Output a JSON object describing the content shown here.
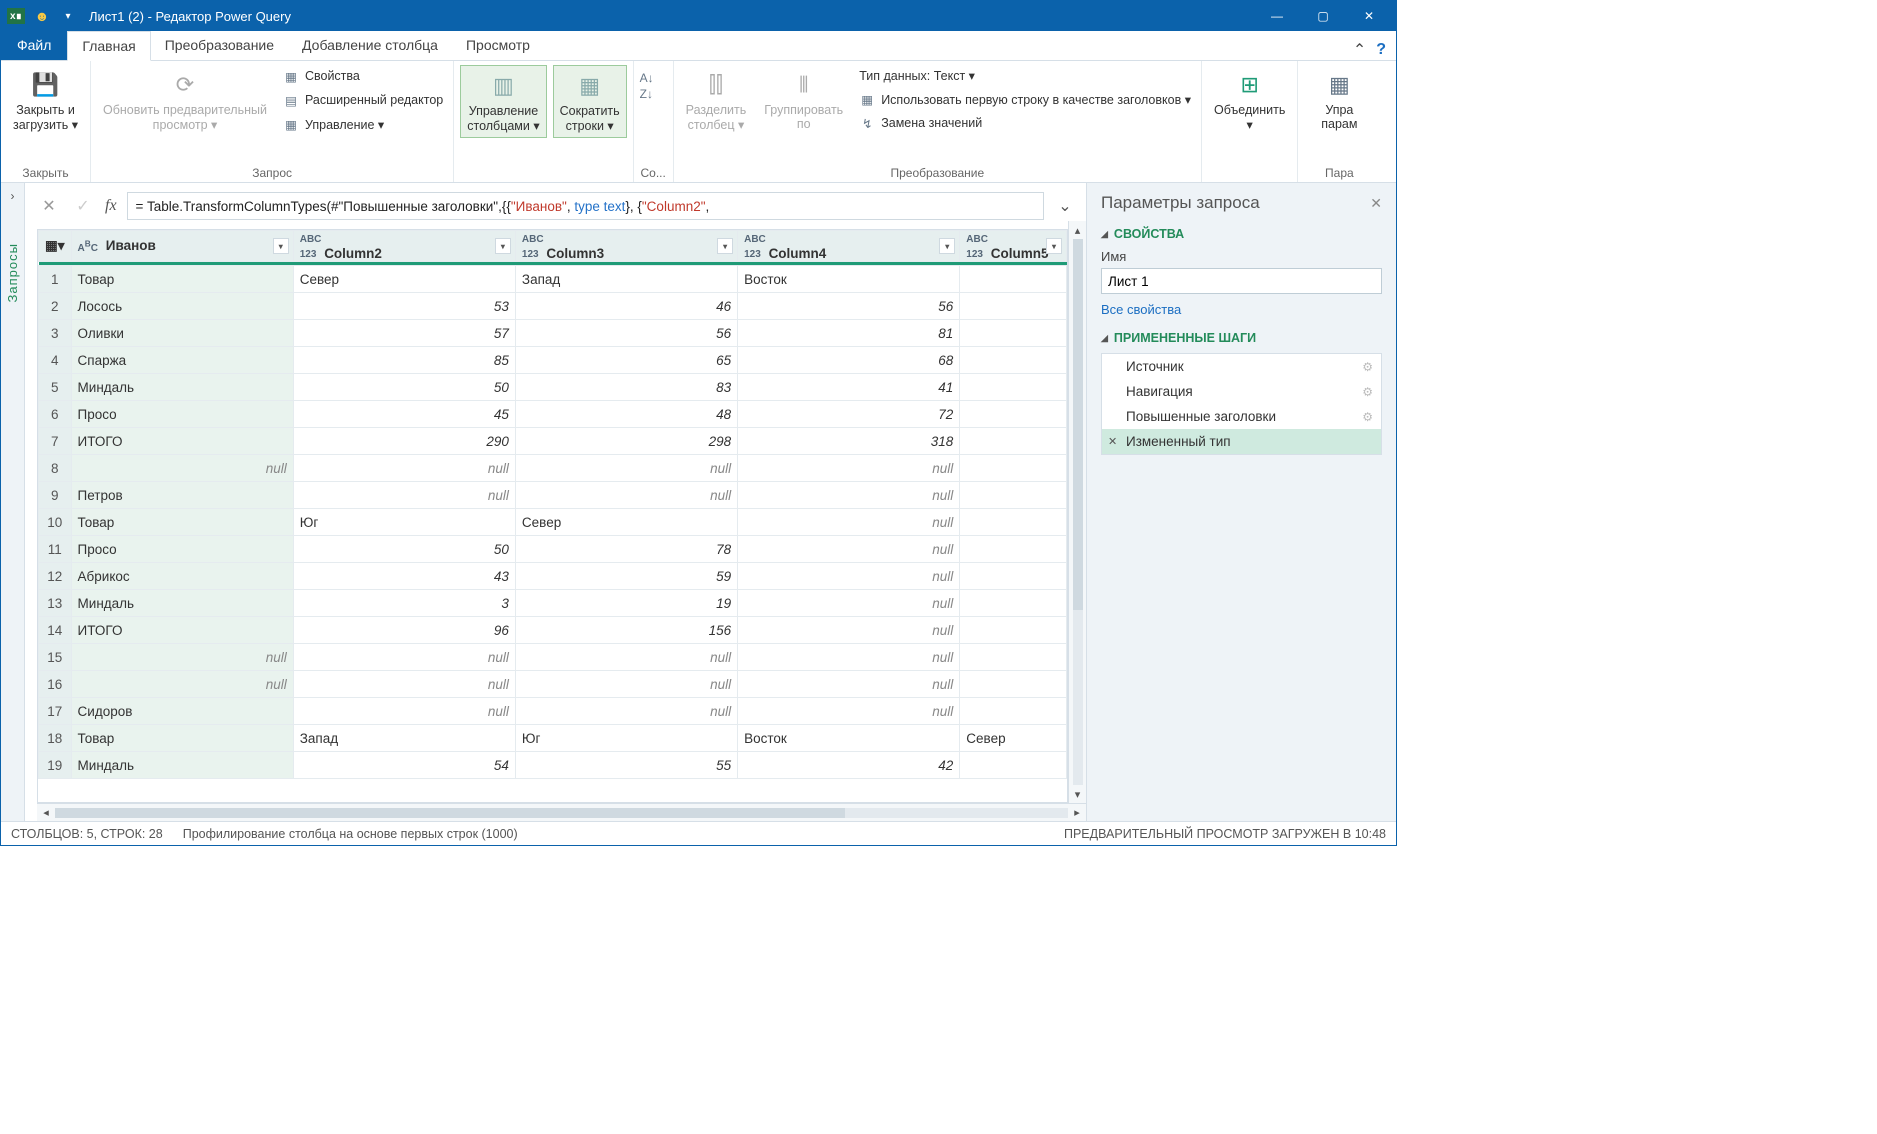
{
  "title": "Лист1 (2) - Редактор Power Query",
  "tabs": {
    "file": "Файл",
    "home": "Главная",
    "transform": "Преобразование",
    "addcol": "Добавление столбца",
    "view": "Просмотр"
  },
  "ribbon": {
    "close": {
      "label": "Закрыть и\nзагрузить ▾",
      "group": "Закрыть"
    },
    "query": {
      "refresh": "Обновить предварительный\nпросмотр ▾",
      "props": "Свойства",
      "adv": "Расширенный редактор",
      "manage": "Управление ▾",
      "group": "Запрос"
    },
    "cols": {
      "manage_cols": "Управление\nстолбцами ▾",
      "reduce_rows": "Сократить\nстроки ▾"
    },
    "sort": {
      "group": "Со..."
    },
    "split": {
      "split": "Разделить\nстолбец ▾",
      "group_by": "Группировать\nпо"
    },
    "transform": {
      "dtype": "Тип данных: Текст ▾",
      "first_row": "Использовать первую строку в качестве заголовков ▾",
      "replace": "Замена значений",
      "group": "Преобразование"
    },
    "combine": {
      "merge": "Объединить\n▾"
    },
    "params": {
      "manage": "Упра\nпарам",
      "group": "Пара"
    }
  },
  "formula": "= Table.TransformColumnTypes(#\"Повышенные заголовки\",{{\"Иванов\", type text}, {\"Column2\",",
  "columns": [
    "Иванов",
    "Column2",
    "Column3",
    "Column4",
    "Column5"
  ],
  "col_types": [
    "ABC",
    "ABC123",
    "ABC123",
    "ABC123",
    "ABC123"
  ],
  "rows": [
    {
      "n": 1,
      "c": [
        "Товар",
        "Север",
        "Запад",
        "Восток",
        ""
      ]
    },
    {
      "n": 2,
      "c": [
        "Лосось",
        "53",
        "46",
        "56",
        ""
      ]
    },
    {
      "n": 3,
      "c": [
        "Оливки",
        "57",
        "56",
        "81",
        ""
      ]
    },
    {
      "n": 4,
      "c": [
        "Спаржа",
        "85",
        "65",
        "68",
        ""
      ]
    },
    {
      "n": 5,
      "c": [
        "Миндаль",
        "50",
        "83",
        "41",
        ""
      ]
    },
    {
      "n": 6,
      "c": [
        "Просо",
        "45",
        "48",
        "72",
        ""
      ]
    },
    {
      "n": 7,
      "c": [
        "ИТОГО",
        "290",
        "298",
        "318",
        ""
      ]
    },
    {
      "n": 8,
      "c": [
        "null",
        "null",
        "null",
        "null",
        ""
      ]
    },
    {
      "n": 9,
      "c": [
        "Петров",
        "null",
        "null",
        "null",
        ""
      ]
    },
    {
      "n": 10,
      "c": [
        "Товар",
        "Юг",
        "Север",
        "null",
        ""
      ]
    },
    {
      "n": 11,
      "c": [
        "Просо",
        "50",
        "78",
        "null",
        ""
      ]
    },
    {
      "n": 12,
      "c": [
        "Абрикос",
        "43",
        "59",
        "null",
        ""
      ]
    },
    {
      "n": 13,
      "c": [
        "Миндаль",
        "3",
        "19",
        "null",
        ""
      ]
    },
    {
      "n": 14,
      "c": [
        "ИТОГО",
        "96",
        "156",
        "null",
        ""
      ]
    },
    {
      "n": 15,
      "c": [
        "null",
        "null",
        "null",
        "null",
        ""
      ]
    },
    {
      "n": 16,
      "c": [
        "null",
        "null",
        "null",
        "null",
        ""
      ]
    },
    {
      "n": 17,
      "c": [
        "Сидоров",
        "null",
        "null",
        "null",
        ""
      ]
    },
    {
      "n": 18,
      "c": [
        "Товар",
        "Запад",
        "Юг",
        "Восток",
        "Север"
      ]
    },
    {
      "n": 19,
      "c": [
        "Миндаль",
        "54",
        "55",
        "42",
        ""
      ]
    }
  ],
  "settings": {
    "title": "Параметры запроса",
    "props": "СВОЙСТВА",
    "name_label": "Имя",
    "name_value": "Лист 1",
    "all_props": "Все свойства",
    "steps_hdr": "ПРИМЕНЕННЫЕ ШАГИ",
    "steps": [
      "Источник",
      "Навигация",
      "Повышенные заголовки",
      "Измененный тип"
    ]
  },
  "queries_label": "Запросы",
  "status": {
    "left": "СТОЛБЦОВ: 5, СТРОК: 28",
    "profiling": "Профилирование столбца на основе первых строк (1000)",
    "right": "ПРЕДВАРИТЕЛЬНЫЙ ПРОСМОТР ЗАГРУЖЕН В 10:48"
  }
}
